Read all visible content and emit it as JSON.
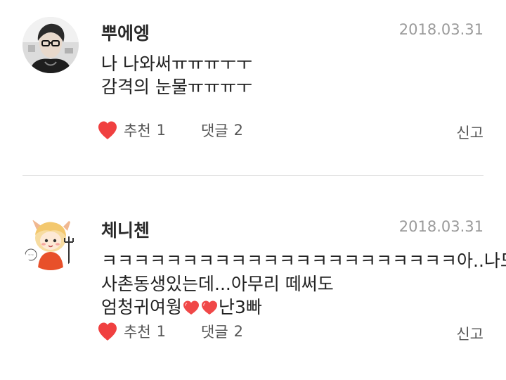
{
  "colors": {
    "heart": "#f04040",
    "date": "#9a9a9a",
    "divider": "#e2e2e2"
  },
  "comments": [
    {
      "author": "뿌에엥",
      "date": "2018.03.31",
      "avatar_icon": "user-photo-avatar",
      "body_lines": [
        "나 나와써ㅠㅠㅠㅜㅜ",
        "감격의 눈물ㅠㅠㅠㅜ"
      ],
      "like_label": "추천",
      "like_count": "1",
      "reply_label": "댓글",
      "reply_count": "2",
      "report_label": "신고"
    },
    {
      "author": "체니첸",
      "date": "2018.03.31",
      "avatar_icon": "devil-character-avatar",
      "body_lines": [
        "ㅋㅋㅋㅋㅋㅋㅋㅋㅋㅋㅋㅋㅋㅋㅋㅋㅋㅋㅋㅋㅋㅋ아..나도",
        "사촌동생있는데...아무리 떼써도",
        "엄청귀여웡",
        "난3빠"
      ],
      "like_label": "추천",
      "like_count": "1",
      "reply_label": "댓글",
      "reply_count": "2",
      "report_label": "신고"
    }
  ]
}
